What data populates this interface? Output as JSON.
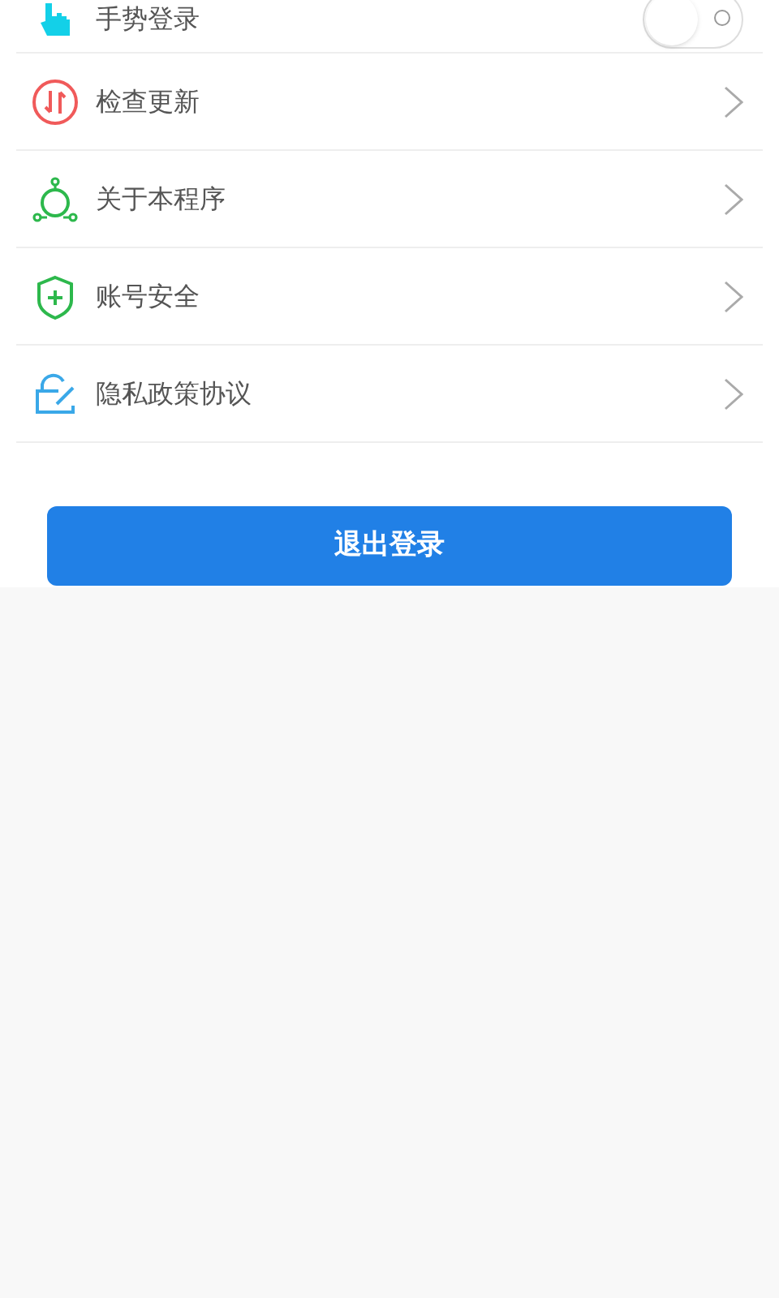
{
  "settings": [
    {
      "kind": "toggle",
      "label": "手势登录",
      "on": false
    },
    {
      "kind": "link",
      "label": "检查更新"
    },
    {
      "kind": "link",
      "label": "关于本程序"
    },
    {
      "kind": "link",
      "label": "账号安全"
    },
    {
      "kind": "link",
      "label": "隐私政策协议"
    }
  ],
  "logout_button": "退出登录"
}
